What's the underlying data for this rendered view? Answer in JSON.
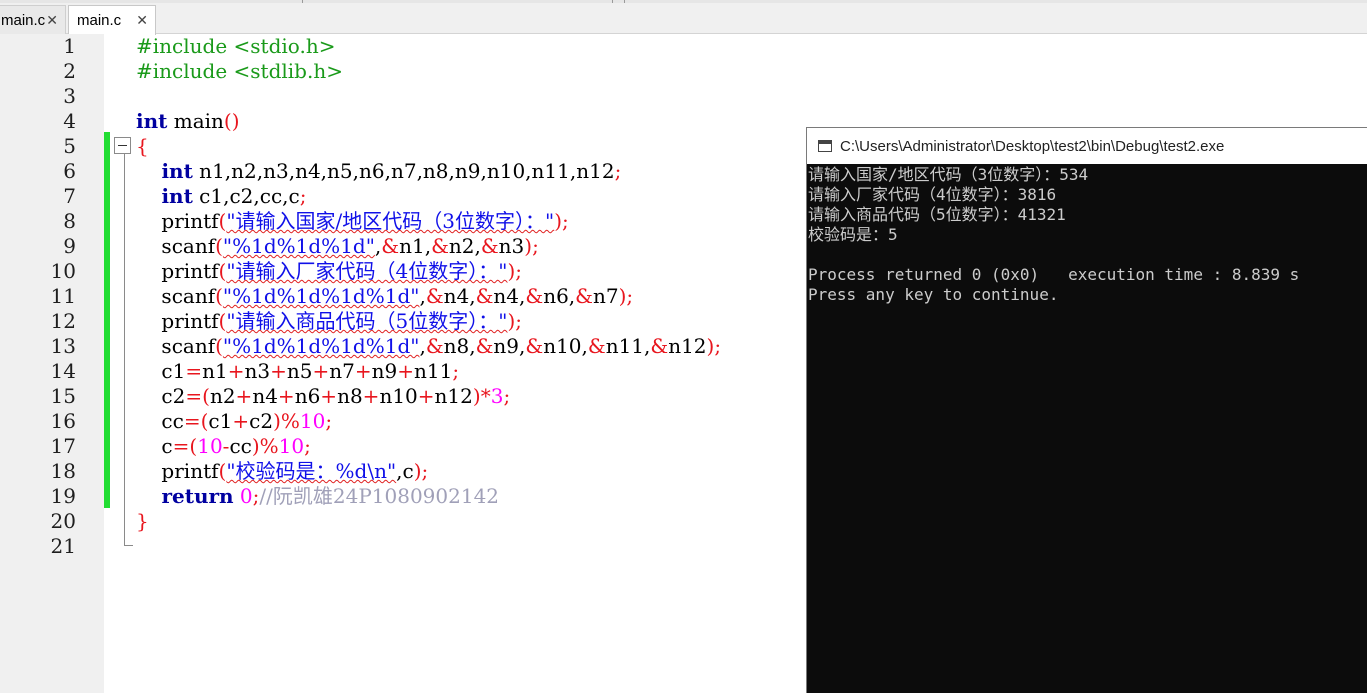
{
  "tabs": [
    {
      "label": "main.c",
      "close": "✕",
      "active": false
    },
    {
      "label": "main.c",
      "close": "✕",
      "active": true
    }
  ],
  "line_numbers": [
    "1",
    "2",
    "3",
    "4",
    "5",
    "6",
    "7",
    "8",
    "9",
    "10",
    "11",
    "12",
    "13",
    "14",
    "15",
    "16",
    "17",
    "18",
    "19",
    "20",
    "21"
  ],
  "code_lines": [
    "#include <stdio.h>",
    "#include <stdlib.h>",
    "",
    "int main()",
    "{",
    "    int n1,n2,n3,n4,n5,n6,n7,n8,n9,n10,n11,n12;",
    "    int c1,c2,cc,c;",
    "    printf(\"请输入国家/地区代码（3位数字）：\");",
    "    scanf(\"%1d%1d%1d\",&n1,&n2,&n3);",
    "    printf(\"请输入厂家代码（4位数字）：\");",
    "    scanf(\"%1d%1d%1d%1d\",&n4,&n4,&n6,&n7);",
    "    printf(\"请输入商品代码（5位数字）：\");",
    "    scanf(\"%1d%1d%1d%1d\",&n8,&n9,&n10,&n11,&n12);",
    "    c1=n1+n3+n5+n7+n9+n11;",
    "    c2=(n2+n4+n6+n8+n10+n12)*3;",
    "    cc=(c1+c2)%10;",
    "    c=(10-cc)%10;",
    "    printf(\"校验码是：%d\\n\",c);",
    "    return 0;//阮凯雄24P1080902142",
    "}",
    ""
  ],
  "console": {
    "title": "C:\\Users\\Administrator\\Desktop\\test2\\bin\\Debug\\test2.exe",
    "lines": [
      "请输入国家/地区代码（3位数字）：534",
      "请输入厂家代码（4位数字）：3816",
      "请输入商品代码（5位数字）：41321",
      "校验码是：5",
      "",
      "Process returned 0 (0x0)   execution time : 8.839 s",
      "Press any key to continue."
    ]
  },
  "colors": {
    "preprocessor": "#1a9a1a",
    "keyword": "#0000a0",
    "operator": "#e8161e",
    "string": "#1010e8",
    "number": "#ff00ff",
    "comment": "#a0a0b8",
    "change_bar": "#22dd33",
    "console_bg": "#0c0c0c",
    "console_text": "#cccccc"
  },
  "icons": [
    "close-icon",
    "fold-collapse-icon",
    "console-app-icon"
  ]
}
